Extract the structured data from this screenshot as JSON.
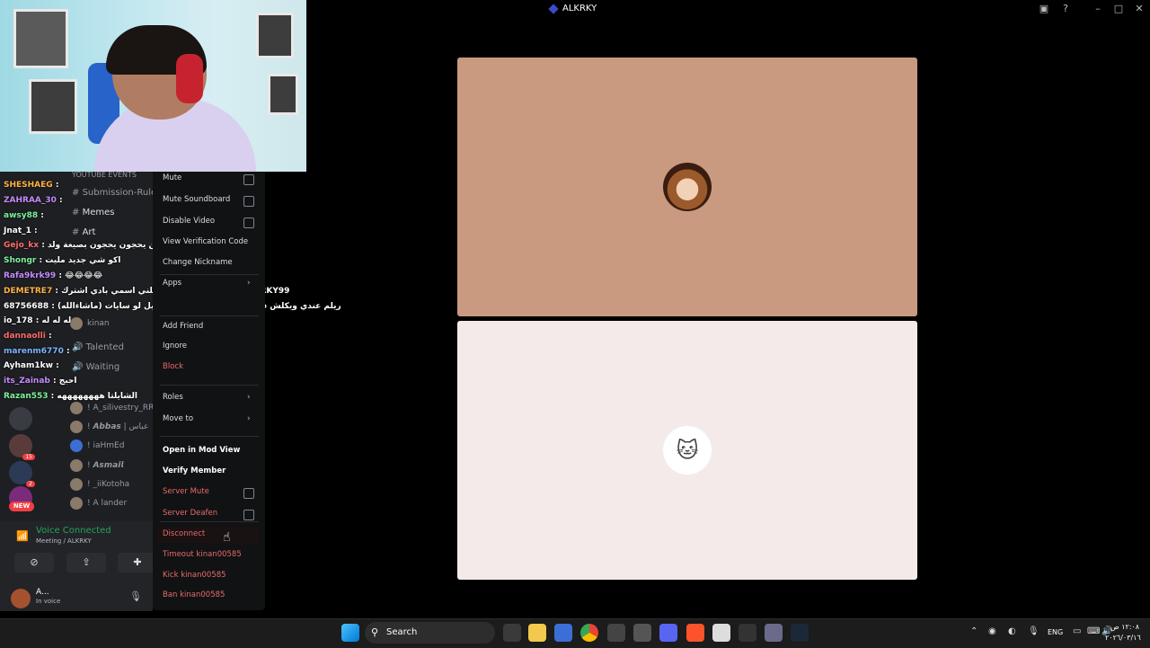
{
  "window": {
    "title": "ALKRKY"
  },
  "sidebar": {
    "channels": [
      {
        "label": "YOUTUBE EVENTS"
      },
      {
        "label": "Submission-Rules"
      },
      {
        "label": "Memes"
      },
      {
        "label": "Art"
      },
      {
        "label": "Talented"
      },
      {
        "label": "Waiting"
      }
    ],
    "members": [
      {
        "name": "kinan"
      },
      {
        "name": "! A_silivestry_RR"
      },
      {
        "name": "! 𝘼𝙗𝙗𝙖𝙨 | عباس"
      },
      {
        "name": "! iaHmEd"
      },
      {
        "name": "! 𝘼𝙨𝙢𝙖𝙞𝙡"
      },
      {
        "name": "! _iiKotoha"
      },
      {
        "name": "! A lander"
      }
    ],
    "new_badge": "NEW",
    "guild_badges": [
      "15",
      "2"
    ]
  },
  "chat_overlay": [
    {
      "user": "SHESHAEG",
      "msg": "",
      "color": "#ffb347"
    },
    {
      "user": "ZAHRAA_30",
      "msg": "",
      "color": "#c58bff"
    },
    {
      "user": "awsy88",
      "msg": "",
      "color": "#7cf29c"
    },
    {
      "user": "Jnat_1",
      "msg": "",
      "color": "#ffffff"
    },
    {
      "user": "Gejo_kx",
      "msg": "من يحجون يحجون بصيغة ولد",
      "color": "#ff6b6b"
    },
    {
      "user": "Shongr",
      "msg": "اكو شي جديد مليت",
      "color": "#7cf29c"
    },
    {
      "user": "Rafa9krk99",
      "msg": "😂😂😂😂",
      "color": "#c58bff"
    },
    {
      "user": "DEMETRE7",
      "msg": "سلام دخلني اسمي بادي اشترك DEMETRE @ALKRKY99",
      "color": "#ffb347"
    },
    {
      "user": "68756688",
      "msg": "ريلم عندي ويكلش فورلاتي بكل بث مونيوزم الكيل لو سايات (ماشاءالله)",
      "color": "#ffffff"
    },
    {
      "user": "io_178",
      "msg": "له له له",
      "color": "#ffffff"
    },
    {
      "user": "dannaolli",
      "msg": "",
      "color": "#ff6b6b"
    },
    {
      "user": "marenm6770",
      "msg": "",
      "color": "#7cb3ff"
    },
    {
      "user": "Ayham1kw",
      "msg": "",
      "color": "#ffffff"
    },
    {
      "user": "its_Zainab",
      "msg": "احبج",
      "color": "#c58bff"
    },
    {
      "user": "Razan553",
      "msg": "الشايلتا ههههههههه",
      "color": "#7cf29c"
    }
  ],
  "voice": {
    "status": "Voice Connected",
    "location": "Meeting / ALKRKY",
    "user_name": "A...",
    "user_status": "In voice"
  },
  "context_menu": {
    "items": [
      {
        "label": "Mute",
        "type": "checkbox"
      },
      {
        "label": "Mute Soundboard",
        "type": "checkbox"
      },
      {
        "label": "Disable Video",
        "type": "checkbox"
      },
      {
        "label": "View Verification Code",
        "type": "plain"
      },
      {
        "label": "Change Nickname",
        "type": "plain"
      },
      {
        "label": "Apps",
        "type": "submenu"
      },
      {
        "label": "Add Friend",
        "type": "plain"
      },
      {
        "label": "Ignore",
        "type": "plain"
      },
      {
        "label": "Block",
        "type": "danger"
      },
      {
        "label": "Roles",
        "type": "submenu"
      },
      {
        "label": "Move to",
        "type": "submenu"
      },
      {
        "label": "Open in Mod View",
        "type": "bold"
      },
      {
        "label": "Verify Member",
        "type": "bold"
      },
      {
        "label": "Server Mute",
        "type": "danger-checkbox"
      },
      {
        "label": "Server Deafen",
        "type": "danger-checkbox"
      },
      {
        "label": "Disconnect",
        "type": "danger"
      },
      {
        "label": "Timeout kinan00585",
        "type": "danger"
      },
      {
        "label": "Kick kinan00585",
        "type": "danger"
      },
      {
        "label": "Ban kinan00585",
        "type": "danger"
      }
    ]
  },
  "taskbar": {
    "search_label": "Search",
    "language": "ENG",
    "time": "١٢:٠٨ ص",
    "date": "٢٠٢٦/٠٣/١٦"
  },
  "colors": {
    "accent_green": "#23a55a",
    "danger": "#f23f43",
    "tile_top": "#c99a80",
    "tile_bottom": "#f5eaea"
  }
}
